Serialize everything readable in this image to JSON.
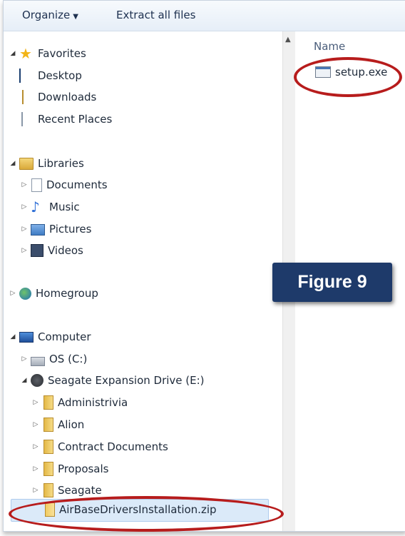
{
  "toolbar": {
    "organize_label": "Organize",
    "extract_label": "Extract all files"
  },
  "content": {
    "column_name": "Name",
    "file_name": "setup.exe"
  },
  "callout": {
    "label": "Figure 9"
  },
  "nav": {
    "favorites": {
      "label": "Favorites",
      "items": [
        "Desktop",
        "Downloads",
        "Recent Places"
      ]
    },
    "libraries": {
      "label": "Libraries",
      "items": [
        "Documents",
        "Music",
        "Pictures",
        "Videos"
      ]
    },
    "homegroup": {
      "label": "Homegroup"
    },
    "computer": {
      "label": "Computer",
      "os_drive": "OS (C:)",
      "external_drive": "Seagate Expansion Drive (E:)",
      "folders": [
        "Administrivia",
        "Alion",
        "Contract Documents",
        "Proposals",
        "Seagate"
      ],
      "selected_file": "AirBaseDriversInstallation.zip"
    }
  },
  "colors": {
    "highlight_ring": "#b71c1c",
    "callout_bg": "#1e3a6a",
    "selection": "#dbeaf9"
  }
}
